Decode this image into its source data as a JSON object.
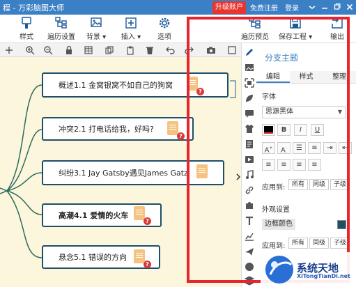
{
  "window": {
    "title": "程 - 万彩脑图大师",
    "upgrade_label": "升级账户",
    "register_label": "免费注册",
    "login_label": "登录"
  },
  "toolbar": {
    "style_label": "样式",
    "traverse_label": "遍历设置",
    "background_label": "背景",
    "insert_label": "插入",
    "options_label": "选项",
    "preview_label": "遍历预览",
    "save_label": "保存工程",
    "export_label": "输出"
  },
  "mindmap": {
    "nodes": [
      {
        "text": "概述1.1 金窝银窝不如自己的狗窝",
        "bold": false
      },
      {
        "text": "冲突2.1 打电话给我，好吗?",
        "bold": false
      },
      {
        "text": "纠纷3.1 Jay Gatsby遇见James Gatz",
        "bold": false
      },
      {
        "text": "高潮4.1 爱情的火车",
        "bold": true
      },
      {
        "text": "悬念5.1 错误的方向",
        "bold": false
      }
    ],
    "note_badge": "?"
  },
  "panel": {
    "title": "分支主题",
    "tabs": [
      "编辑",
      "样式",
      "整理"
    ],
    "font_section": "字体",
    "font_name": "思源黑体",
    "bold_btn": "B",
    "italic_btn": "I",
    "underline_btn": "U",
    "apply_label": "应用到:",
    "apply_all": "所有",
    "apply_same": "同级",
    "apply_child": "子级",
    "appearance_section": "外观设置",
    "border_color_label": "边框颜色",
    "apply_label_2": "应用到:",
    "apply_all_2": "所有",
    "apply_same_2": "同级",
    "apply_child_2": "子级",
    "bottom_label": "应"
  },
  "watermark": {
    "cn": "系统天地",
    "en": "XiTongTianDi.net"
  },
  "colors": {
    "titlebar": "#3b7fc4",
    "highlight": "#e8242c",
    "canvas": "#fbf6dc",
    "node_border": "#1e4f6a",
    "accent": "#3b7fc4"
  }
}
